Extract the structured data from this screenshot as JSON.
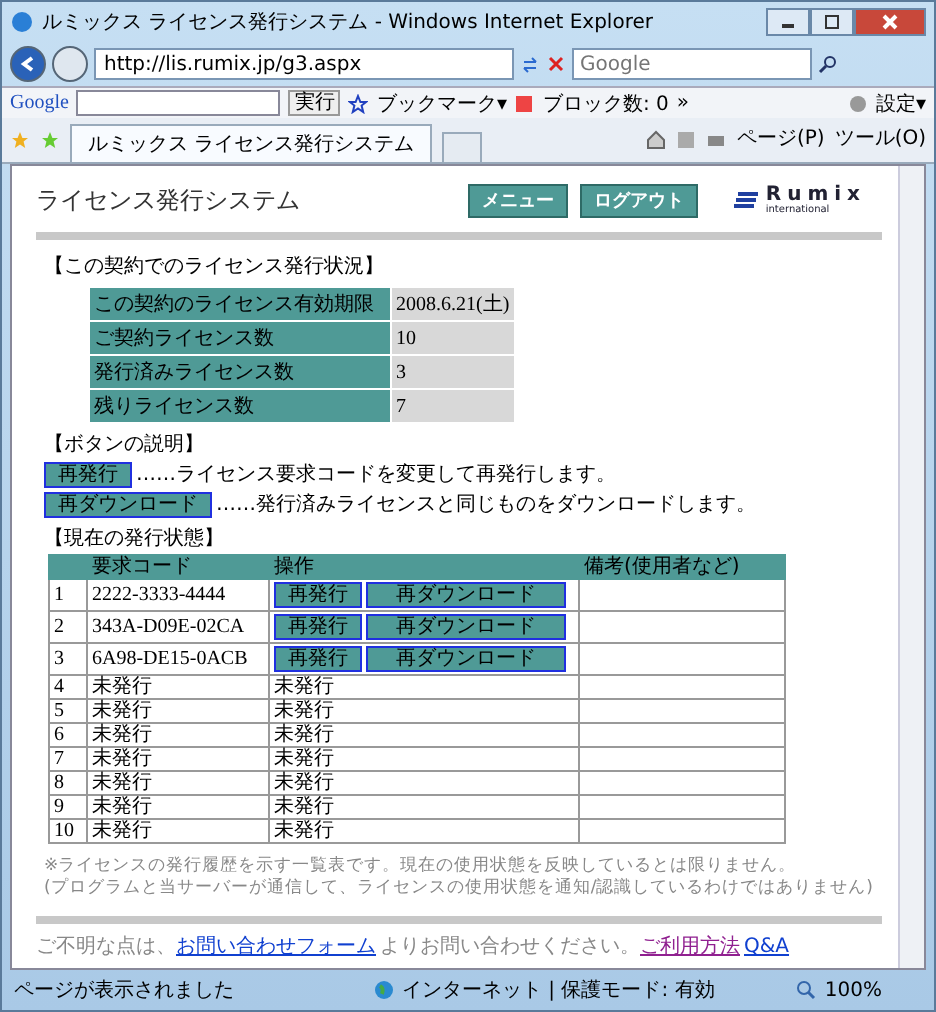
{
  "window": {
    "title": "ルミックス ライセンス発行システム - Windows Internet Explorer"
  },
  "address_bar": {
    "url": "http://lis.rumix.jp/g3.aspx",
    "search_placeholder": "Google"
  },
  "google_toolbar": {
    "logo": "Google",
    "go": "実行",
    "bookmarks": "ブックマーク▾",
    "blocked": "ブロック数: 0",
    "more": "»",
    "settings": "設定▾"
  },
  "tabs": [
    {
      "label": "ルミックス ライセンス発行システム",
      "selected": true
    }
  ],
  "command_bar": {
    "page": "ページ(P)",
    "tools": "ツール(O)"
  },
  "page": {
    "title": "ライセンス発行システム",
    "nav": [
      "メニュー",
      "ログアウト"
    ],
    "logo": "Rumix",
    "logo_sub": "international",
    "status_heading": "【この契約でのライセンス発行状況】",
    "info": [
      {
        "label": "この契約のライセンス有効期限",
        "value": "2008.6.21(土)"
      },
      {
        "label": "ご契約ライセンス数",
        "value": "10"
      },
      {
        "label": "発行済みライセンス数",
        "value": "3"
      },
      {
        "label": "残りライセンス数",
        "value": "7"
      }
    ],
    "legend_heading": "【ボタンの説明】",
    "legend": [
      {
        "button": "再発行",
        "text": "……ライセンス要求コードを変更して再発行します。"
      },
      {
        "button": "再ダウンロード",
        "text": "……発行済みライセンスと同じものをダウンロードします。"
      }
    ],
    "table_heading": "【現在の発行状態】",
    "columns": [
      "要求コード",
      "操作",
      "備考(使用者など)"
    ],
    "rows": [
      {
        "no": "1",
        "kind": "issued",
        "code": "2222-3333-4444",
        "actions": [
          "再発行",
          "再ダウンロード"
        ]
      },
      {
        "no": "2",
        "kind": "issued",
        "code": "343A-D09E-02CA",
        "actions": [
          "再発行",
          "再ダウンロード"
        ]
      },
      {
        "no": "3",
        "kind": "issued",
        "code": "6A98-DE15-0ACB",
        "actions": [
          "再発行",
          "再ダウンロード"
        ]
      },
      {
        "no": "4",
        "kind": "pending",
        "code": "未発行",
        "status": "未発行"
      },
      {
        "no": "5",
        "kind": "pending",
        "code": "未発行",
        "status": "未発行"
      },
      {
        "no": "6",
        "kind": "pending",
        "code": "未発行",
        "status": "未発行"
      },
      {
        "no": "7",
        "kind": "pending",
        "code": "未発行",
        "status": "未発行"
      },
      {
        "no": "8",
        "kind": "pending",
        "code": "未発行",
        "status": "未発行"
      },
      {
        "no": "9",
        "kind": "pending",
        "code": "未発行",
        "status": "未発行"
      },
      {
        "no": "10",
        "kind": "pending",
        "code": "未発行",
        "status": "未発行"
      }
    ],
    "notes": [
      "※ライセンスの発行履歴を示す一覧表です。現在の使用状態を反映しているとは限りません。",
      "(プログラムと当サーバーが通信して、ライセンスの使用状態を通知/認識しているわけではありません)"
    ],
    "footer": [
      {
        "kind": "text",
        "text": "ご不明な点は、"
      },
      {
        "kind": "link",
        "text": "お問い合わせフォーム",
        "visited": false
      },
      {
        "kind": "text",
        "text": "よりお問い合わせください。"
      },
      {
        "kind": "link",
        "text": "ご利用方法",
        "visited": true
      },
      {
        "kind": "link",
        "text": "Q&A",
        "visited": false
      }
    ]
  },
  "status_bar": {
    "text": "ページが表示されました",
    "zone": "インターネット | 保護モード: 有効",
    "zoom": "100%"
  }
}
